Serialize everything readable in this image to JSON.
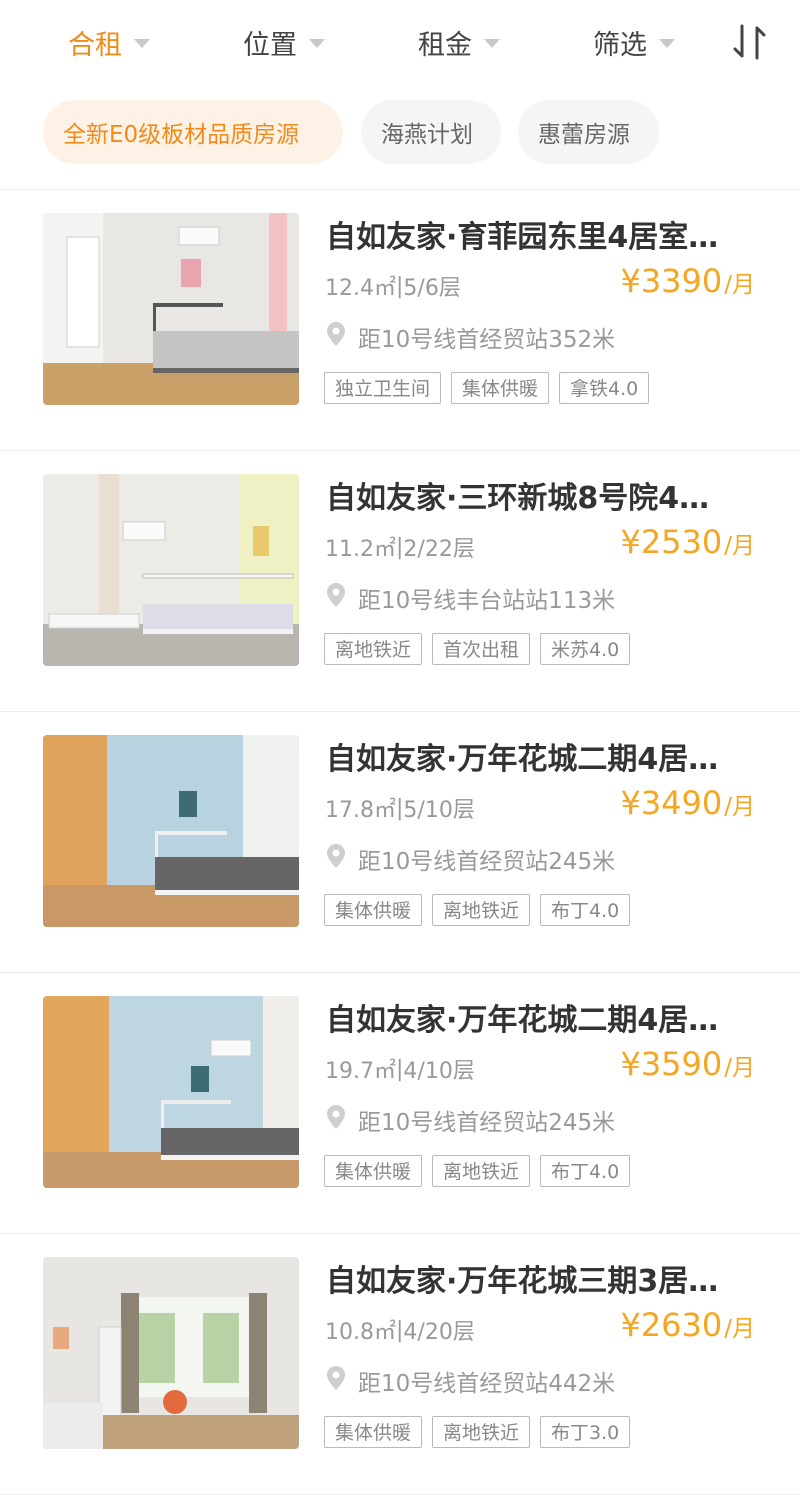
{
  "filters": [
    {
      "label": "合租",
      "active": true
    },
    {
      "label": "位置",
      "active": false
    },
    {
      "label": "租金",
      "active": false
    },
    {
      "label": "筛选",
      "active": false
    }
  ],
  "tags": [
    {
      "label": "全新E0级板材品质房源",
      "active": true
    },
    {
      "label": "海燕计划",
      "active": false
    },
    {
      "label": "惠蕾房源",
      "active": false
    }
  ],
  "listings": [
    {
      "title": "自如友家·育菲园东里4居室…",
      "area": "12.4㎡",
      "floor": "5/6层",
      "price": "¥3390",
      "unit": "/月",
      "location": "距10号线首经贸站352米",
      "tags": [
        "独立卫生间",
        "集体供暖",
        "拿铁4.0"
      ]
    },
    {
      "title": "自如友家·三环新城8号院4…",
      "area": "11.2㎡",
      "floor": "2/22层",
      "price": "¥2530",
      "unit": "/月",
      "location": "距10号线丰台站站113米",
      "tags": [
        "离地铁近",
        "首次出租",
        "米苏4.0"
      ]
    },
    {
      "title": "自如友家·万年花城二期4居…",
      "area": "17.8㎡",
      "floor": "5/10层",
      "price": "¥3490",
      "unit": "/月",
      "location": "距10号线首经贸站245米",
      "tags": [
        "集体供暖",
        "离地铁近",
        "布丁4.0"
      ]
    },
    {
      "title": "自如友家·万年花城二期4居…",
      "area": "19.7㎡",
      "floor": "4/10层",
      "price": "¥3590",
      "unit": "/月",
      "location": "距10号线首经贸站245米",
      "tags": [
        "集体供暖",
        "离地铁近",
        "布丁4.0"
      ]
    },
    {
      "title": "自如友家·万年花城三期3居…",
      "area": "10.8㎡",
      "floor": "4/20层",
      "price": "¥2630",
      "unit": "/月",
      "location": "距10号线首经贸站442米",
      "tags": [
        "集体供暖",
        "离地铁近",
        "布丁3.0"
      ]
    }
  ],
  "colors": {
    "accent": "#f08b19",
    "price": "#f5a623",
    "chip_active_bg": "#fef2e6"
  },
  "icons": {
    "sort": "sort-arrows-icon",
    "caret": "caret-down-icon",
    "location": "location-pin-icon"
  }
}
